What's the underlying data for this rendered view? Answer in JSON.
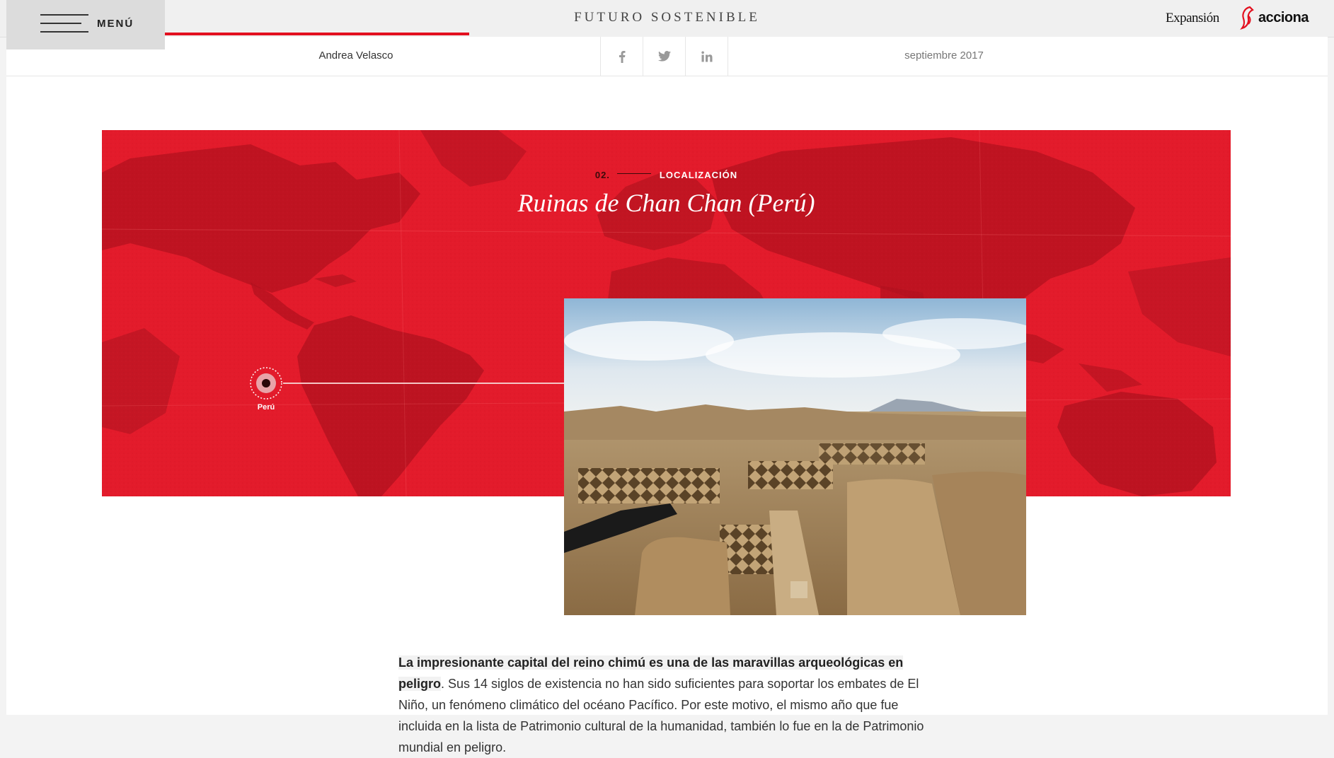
{
  "header": {
    "menu_label": "MENÚ",
    "site_title": "FUTURO SOSTENIBLE",
    "brand_expansion": "Expansión",
    "brand_acciona": "acciona",
    "accent_color": "#e3101f"
  },
  "article_meta": {
    "author": "Andrea Velasco",
    "date": "septiembre 2017",
    "share": [
      {
        "network": "facebook",
        "icon": "facebook-icon"
      },
      {
        "network": "twitter",
        "icon": "twitter-icon"
      },
      {
        "network": "linkedin",
        "icon": "linkedin-icon"
      }
    ]
  },
  "hero": {
    "section_number": "02.",
    "section_label": "LOCALIZACIÓN",
    "title": "Ruinas de Chan Chan (Perú)",
    "pin_label": "Perú",
    "background_color": "#e31b2b"
  },
  "body": {
    "lead": "La impresionante capital del reino chimú es una de las maravillas arqueológicas en peligro",
    "text": ". Sus 14 siglos de existencia no han sido suficientes para soportar los embates de El Niño, un fenómeno climático del océano Pacífico. Por este motivo, el mismo año que fue incluida en la lista de Patrimonio cultural de la humanidad, también lo fue en la de Patrimonio mundial en peligro."
  }
}
